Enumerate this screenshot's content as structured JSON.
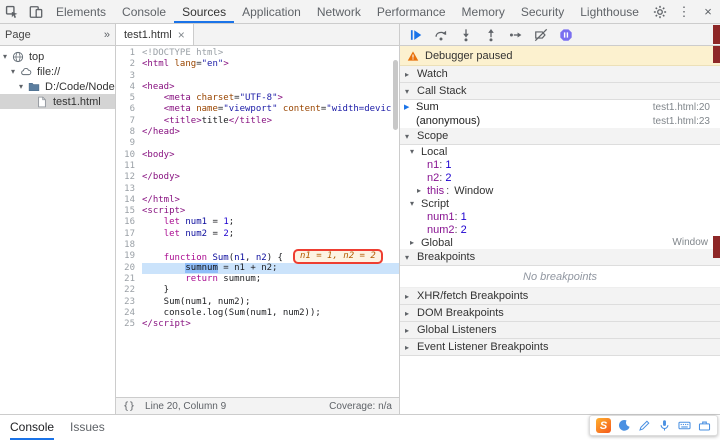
{
  "toolbar": {
    "tabs": [
      "Elements",
      "Console",
      "Sources",
      "Application",
      "Network",
      "Performance",
      "Memory",
      "Security",
      "Lighthouse"
    ],
    "active_tab": "Sources",
    "kebab_glyph": "⋮",
    "close_glyph": "×"
  },
  "navigator": {
    "pane_title": "Page",
    "overflow_glyph": "»",
    "tree": [
      {
        "label": "top",
        "icon": "globe",
        "depth": 0,
        "expander": "▾",
        "selected": false
      },
      {
        "label": "file://",
        "icon": "cloud",
        "depth": 1,
        "expander": "▾",
        "selected": false
      },
      {
        "label": "D:/Code/NodeJS",
        "icon": "folder",
        "depth": 2,
        "expander": "▾",
        "selected": false
      },
      {
        "label": "test1.html",
        "icon": "file",
        "depth": 3,
        "expander": "",
        "selected": true
      }
    ]
  },
  "editor": {
    "tab_label": "test1.html",
    "close_label": "×",
    "current_line": 20,
    "inline_eval": "n1 = 1, n2 = 2",
    "status_bar": {
      "format_icon": "{}",
      "position": "Line 20, Column 9",
      "coverage": "Coverage: n/a"
    },
    "lines": [
      {
        "n": 1,
        "tokens": [
          [
            "doc",
            "<!DOCTYPE html>"
          ]
        ]
      },
      {
        "n": 2,
        "tokens": [
          [
            "tag",
            "<html "
          ],
          [
            "attr",
            "lang"
          ],
          [
            "pln",
            "="
          ],
          [
            "str",
            "\"en\""
          ],
          [
            "tag",
            ">"
          ]
        ]
      },
      {
        "n": 3,
        "tokens": []
      },
      {
        "n": 4,
        "tokens": [
          [
            "tag",
            "<head>"
          ]
        ]
      },
      {
        "n": 5,
        "tokens": [
          [
            "pln",
            "    "
          ],
          [
            "tag",
            "<meta "
          ],
          [
            "attr",
            "charset"
          ],
          [
            "pln",
            "="
          ],
          [
            "str",
            "\"UTF-8\""
          ],
          [
            "tag",
            ">"
          ]
        ]
      },
      {
        "n": 6,
        "tokens": [
          [
            "pln",
            "    "
          ],
          [
            "tag",
            "<meta "
          ],
          [
            "attr",
            "name"
          ],
          [
            "pln",
            "="
          ],
          [
            "str",
            "\"viewport\""
          ],
          [
            "pln",
            " "
          ],
          [
            "attr",
            "content"
          ],
          [
            "pln",
            "="
          ],
          [
            "str",
            "\"width=devic"
          ]
        ]
      },
      {
        "n": 7,
        "tokens": [
          [
            "pln",
            "    "
          ],
          [
            "tag",
            "<title>"
          ],
          [
            "pln",
            "title"
          ],
          [
            "tag",
            "</title>"
          ]
        ]
      },
      {
        "n": 8,
        "tokens": [
          [
            "tag",
            "</head>"
          ]
        ]
      },
      {
        "n": 9,
        "tokens": []
      },
      {
        "n": 10,
        "tokens": [
          [
            "tag",
            "<body>"
          ]
        ]
      },
      {
        "n": 11,
        "tokens": []
      },
      {
        "n": 12,
        "tokens": [
          [
            "tag",
            "</body>"
          ]
        ]
      },
      {
        "n": 13,
        "tokens": []
      },
      {
        "n": 14,
        "tokens": [
          [
            "tag",
            "</html>"
          ]
        ]
      },
      {
        "n": 15,
        "tokens": [
          [
            "tag",
            "<script>"
          ]
        ]
      },
      {
        "n": 16,
        "tokens": [
          [
            "pln",
            "    "
          ],
          [
            "kwd",
            "let"
          ],
          [
            "pln",
            " "
          ],
          [
            "def",
            "num1"
          ],
          [
            "pln",
            " = "
          ],
          [
            "num",
            "1"
          ],
          [
            "pln",
            ";"
          ]
        ]
      },
      {
        "n": 17,
        "tokens": [
          [
            "pln",
            "    "
          ],
          [
            "kwd",
            "let"
          ],
          [
            "pln",
            " "
          ],
          [
            "def",
            "num2"
          ],
          [
            "pln",
            " = "
          ],
          [
            "num",
            "2"
          ],
          [
            "pln",
            ";"
          ]
        ]
      },
      {
        "n": 18,
        "tokens": []
      },
      {
        "n": 19,
        "eval": true,
        "tokens": [
          [
            "pln",
            "    "
          ],
          [
            "kwd",
            "function"
          ],
          [
            "pln",
            " "
          ],
          [
            "def",
            "Sum"
          ],
          [
            "pln",
            "("
          ],
          [
            "def",
            "n1"
          ],
          [
            "pln",
            ", "
          ],
          [
            "def",
            "n2"
          ],
          [
            "pln",
            ") {"
          ]
        ]
      },
      {
        "n": 20,
        "tokens": [
          [
            "pln",
            "        "
          ],
          [
            "hl",
            "sumnum"
          ],
          [
            "pln",
            " = n1 + n2;"
          ]
        ]
      },
      {
        "n": 21,
        "tokens": [
          [
            "pln",
            "        "
          ],
          [
            "kwd",
            "return"
          ],
          [
            "pln",
            " sumnum;"
          ]
        ]
      },
      {
        "n": 22,
        "tokens": [
          [
            "pln",
            "    }"
          ]
        ]
      },
      {
        "n": 23,
        "tokens": [
          [
            "pln",
            "    Sum(num1, num2);"
          ]
        ]
      },
      {
        "n": 24,
        "tokens": [
          [
            "pln",
            "    console.log(Sum(num1, num2));"
          ]
        ]
      },
      {
        "n": 25,
        "tokens": [
          [
            "tag",
            "</script>"
          ]
        ]
      }
    ]
  },
  "debugger": {
    "toolbar_icons": [
      "resume",
      "step-over",
      "step-into",
      "step-out",
      "step",
      "deactivate-breakpoints",
      "pause-on-exceptions"
    ],
    "paused_banner": "Debugger paused",
    "watch": {
      "label": "Watch",
      "collapsed": true
    },
    "call_stack": {
      "label": "Call Stack",
      "collapsed": false,
      "frames": [
        {
          "name": "Sum",
          "location": "test1.html:20",
          "current": true
        },
        {
          "name": "(anonymous)",
          "location": "test1.html:23",
          "current": false
        }
      ]
    },
    "scope": {
      "label": "Scope",
      "collapsed": false,
      "entries": [
        {
          "kind": "group",
          "label": "Local",
          "collapsed": false
        },
        {
          "kind": "var",
          "name": "n1",
          "value": "1",
          "value_type": "number"
        },
        {
          "kind": "var",
          "name": "n2",
          "value": "2",
          "value_type": "number"
        },
        {
          "kind": "var",
          "name": "this",
          "value": "Window",
          "value_type": "object",
          "expandable": true
        },
        {
          "kind": "group",
          "label": "Script",
          "collapsed": false
        },
        {
          "kind": "var",
          "name": "num1",
          "value": "1",
          "value_type": "number"
        },
        {
          "kind": "var",
          "name": "num2",
          "value": "2",
          "value_type": "number"
        },
        {
          "kind": "group",
          "label": "Global",
          "collapsed": true,
          "annotation": "Window"
        }
      ]
    },
    "breakpoints": {
      "label": "Breakpoints",
      "collapsed": false,
      "empty_message": "No breakpoints"
    },
    "more_sections": [
      {
        "label": "XHR/fetch Breakpoints",
        "collapsed": true
      },
      {
        "label": "DOM Breakpoints",
        "collapsed": true
      },
      {
        "label": "Global Listeners",
        "collapsed": true
      },
      {
        "label": "Event Listener Breakpoints",
        "collapsed": true
      }
    ]
  },
  "drawer": {
    "tabs": [
      "Console",
      "Issues"
    ],
    "active_tab": "Console"
  },
  "ime": {
    "logo": "S",
    "icons": [
      "moon",
      "pen",
      "mic",
      "keyboard",
      "toolbox"
    ]
  },
  "colors": {
    "accent": "#1a73e8",
    "annotation_red": "#ee3e31",
    "exec_line_blue": "#cbe3fb",
    "paused_banner_bg": "#fcf1cf"
  }
}
